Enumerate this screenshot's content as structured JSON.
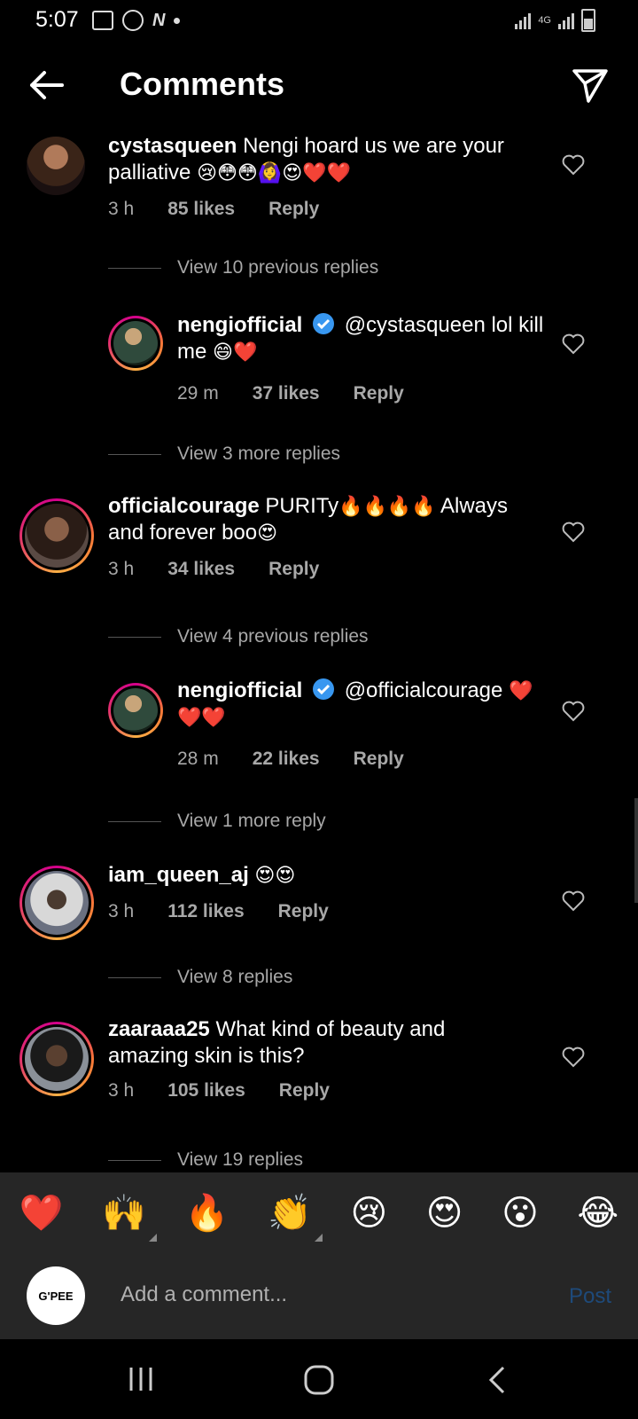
{
  "status_bar": {
    "time": "5:07",
    "network": "4G"
  },
  "header": {
    "title": "Comments"
  },
  "comments": [
    {
      "user": "cystasqueen",
      "text": "Nengi hoard us we are your",
      "text2": "palliative",
      "emojis": "😢😳😳🙆‍♀️😍❤️❤️",
      "time": "3 h",
      "likes": "85 likes",
      "reply": "Reply"
    },
    {
      "user": "nengiofficial",
      "text": "@cystasqueen lol kill",
      "text2": "me",
      "emojis": "😄❤️",
      "time": "29 m",
      "likes": "37 likes",
      "reply": "Reply"
    },
    {
      "user": "officialcourage",
      "text": "PURITy",
      "emojis": "🔥🔥🔥🔥",
      "text_after": "Always",
      "text2": "and forever boo",
      "emojis2": "😍",
      "time": "3 h",
      "likes": "34 likes",
      "reply": "Reply"
    },
    {
      "user": "nengiofficial",
      "text": "@officialcourage",
      "emojis": "❤️",
      "emojis2": "❤️❤️",
      "time": "28 m",
      "likes": "22 likes",
      "reply": "Reply"
    },
    {
      "user": "iam_queen_aj",
      "emojis": "😍😍",
      "time": "3 h",
      "likes": "112 likes",
      "reply": "Reply"
    },
    {
      "user": "zaaraaa25",
      "text": "What kind of beauty and",
      "text2": "amazing skin is this?",
      "time": "3 h",
      "likes": "105 likes",
      "reply": "Reply"
    }
  ],
  "view_more": [
    "View 10 previous replies",
    "View 3 more replies",
    "View 4 previous replies",
    "View 1 more reply",
    "View 8 replies",
    "View 19 replies"
  ],
  "emoji_bar": [
    "❤️",
    "🙌",
    "🔥",
    "👏",
    "😢",
    "😍",
    "😮",
    "😂"
  ],
  "compose": {
    "avatar_label": "G'PEE",
    "placeholder": "Add a comment...",
    "post_label": "Post"
  },
  "colors": {
    "background": "#000000",
    "muted_text": "#a8a8a8",
    "post_disabled": "#1e4a7a",
    "verified": "#3897f0",
    "bar": "#262626"
  },
  "icons": [
    "back-arrow-icon",
    "send-icon",
    "heart-outline-icon",
    "verified-badge-icon",
    "recent-apps-icon",
    "home-icon",
    "back-icon"
  ]
}
